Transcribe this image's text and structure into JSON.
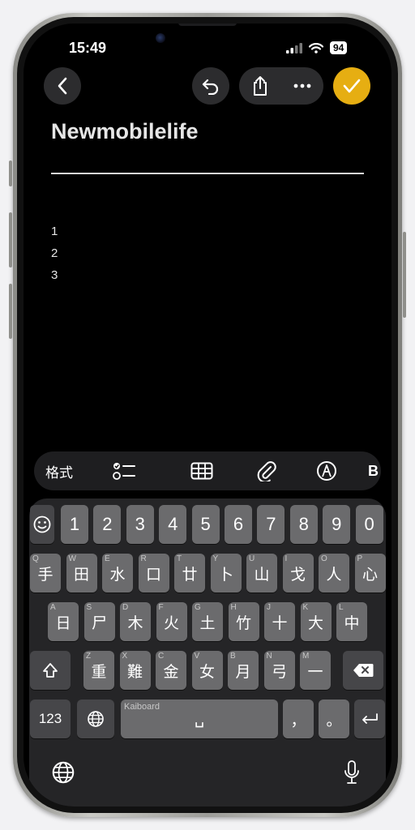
{
  "status": {
    "time": "15:49",
    "battery": "94"
  },
  "note": {
    "title": "Newmobilelife",
    "lines": [
      "1",
      "2",
      "3"
    ]
  },
  "toolbar": {
    "format_label": "格式",
    "partial_label": "B"
  },
  "keyboard": {
    "number_row": [
      "1",
      "2",
      "3",
      "4",
      "5",
      "6",
      "7",
      "8",
      "9",
      "0"
    ],
    "row1": [
      {
        "latin": "Q",
        "char": "手"
      },
      {
        "latin": "W",
        "char": "田"
      },
      {
        "latin": "E",
        "char": "水"
      },
      {
        "latin": "R",
        "char": "口"
      },
      {
        "latin": "T",
        "char": "廿"
      },
      {
        "latin": "Y",
        "char": "卜"
      },
      {
        "latin": "U",
        "char": "山"
      },
      {
        "latin": "I",
        "char": "戈"
      },
      {
        "latin": "O",
        "char": "人"
      },
      {
        "latin": "P",
        "char": "心"
      }
    ],
    "row2": [
      {
        "latin": "A",
        "char": "日"
      },
      {
        "latin": "S",
        "char": "尸"
      },
      {
        "latin": "D",
        "char": "木"
      },
      {
        "latin": "F",
        "char": "火"
      },
      {
        "latin": "G",
        "char": "土"
      },
      {
        "latin": "H",
        "char": "竹"
      },
      {
        "latin": "J",
        "char": "十"
      },
      {
        "latin": "K",
        "char": "大"
      },
      {
        "latin": "L",
        "char": "中"
      }
    ],
    "row3": [
      {
        "latin": "Z",
        "char": "重"
      },
      {
        "latin": "X",
        "char": "難"
      },
      {
        "latin": "C",
        "char": "金"
      },
      {
        "latin": "V",
        "char": "女"
      },
      {
        "latin": "B",
        "char": "月"
      },
      {
        "latin": "N",
        "char": "弓"
      },
      {
        "latin": "M",
        "char": "一"
      }
    ],
    "numbers_key": "123",
    "space_hint": "Kaiboard",
    "space_glyph": "␣",
    "comma": "，",
    "period": "。"
  },
  "icons": [
    "back-icon",
    "undo-icon",
    "share-icon",
    "more-icon",
    "done-check-icon",
    "checklist-icon",
    "table-icon",
    "attachment-icon",
    "markup-pen-icon",
    "emoji-icon",
    "shift-icon",
    "delete-icon",
    "globe-icon",
    "return-icon",
    "microphone-icon"
  ],
  "colors": {
    "accent": "#e6ae12",
    "key": "#6b6b6d",
    "key_dark": "#464649",
    "background": "#000000"
  }
}
